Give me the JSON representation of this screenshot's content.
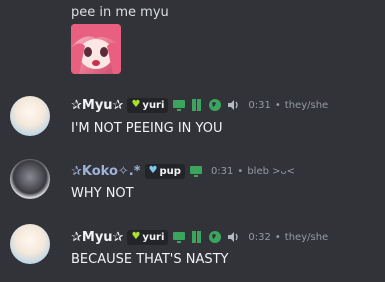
{
  "top": {
    "text": "pee in me myu"
  },
  "messages": [
    {
      "username": "✰Myu✰",
      "tag": "yuri",
      "time": "0:31",
      "pronouns": "they/she",
      "text": "I'M NOT PEEING IN YOU"
    },
    {
      "username": "✰Koko✧.*",
      "tag": "pup",
      "time": "0:31",
      "status": "bleb >ᴗ<",
      "text": "WHY NOT"
    },
    {
      "username": "✰Myu✰",
      "tag": "yuri",
      "time": "0:32",
      "pronouns": "they/she",
      "text": "BECAUSE THAT'S NASTY"
    }
  ],
  "colors": {
    "background": "#313338",
    "text": "#dbdee1",
    "muted": "#949ba4",
    "green_icon": "#3ba55d",
    "yuri_heart": "#a6e22e",
    "pup_heart": "#7ec8f0",
    "koko_name": "#9eb2d8"
  },
  "icons": {
    "tag_heart": "heart-icon",
    "monitor": "monitor-icon",
    "book": "book-icon",
    "globe": "globe-icon",
    "speaker": "speaker-icon"
  }
}
